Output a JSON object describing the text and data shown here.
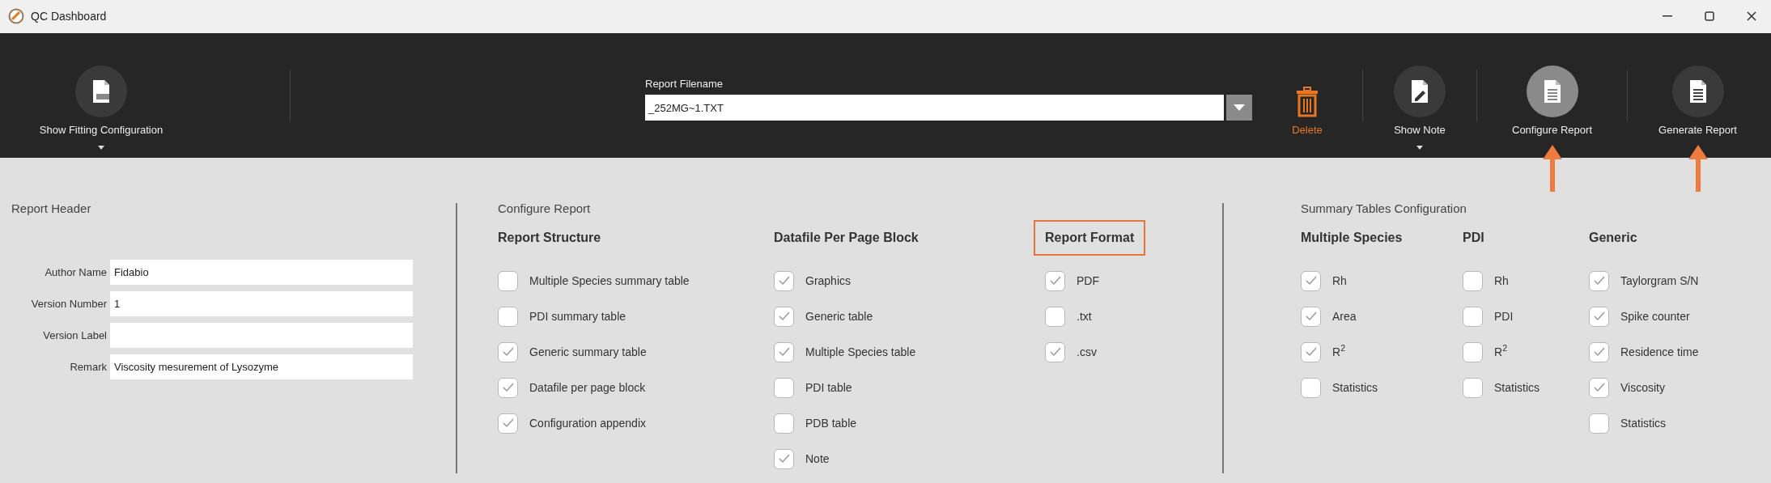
{
  "window": {
    "title": "QC Dashboard"
  },
  "toolbar": {
    "left_buttons": [
      {
        "label": "Show Fitting Configuration",
        "kind": "menu",
        "selected": false,
        "annotated": false
      }
    ],
    "filename": {
      "label": "Report Filename",
      "value": "_252MG~1.TXT"
    },
    "right_buttons": [
      {
        "label": "Delete",
        "kind": "delete",
        "annotated": false
      },
      {
        "label": "Show Note",
        "kind": "menu",
        "selected": false,
        "annotated": false
      },
      {
        "label": "Configure Report",
        "kind": "action",
        "selected": true,
        "annotated": true
      },
      {
        "label": "Generate Report",
        "kind": "action",
        "selected": false,
        "annotated": true
      }
    ]
  },
  "report_header": {
    "title": "Report Header",
    "fields": [
      {
        "label": "Author Name",
        "value": "Fidabio"
      },
      {
        "label": "Version Number",
        "value": "1"
      },
      {
        "label": "Version Label"
      },
      {
        "label": "Remark",
        "value": "Viscosity mesurement of Lysozyme"
      }
    ]
  },
  "configure_report": {
    "title": "Configure Report",
    "groups": [
      {
        "heading": "Report Structure",
        "highlighted": false,
        "options": [
          {
            "label": "Multiple Species summary table",
            "checked": false
          },
          {
            "label": "PDI summary table",
            "checked": false
          },
          {
            "label": "Generic summary table",
            "checked": true
          },
          {
            "label": "Datafile per page block",
            "checked": true
          },
          {
            "label": "Configuration appendix",
            "checked": true
          }
        ]
      },
      {
        "heading": "Datafile Per Page Block",
        "highlighted": false,
        "options": [
          {
            "label": "Graphics",
            "checked": true
          },
          {
            "label": "Generic table",
            "checked": true
          },
          {
            "label": "Multiple Species table",
            "checked": true
          },
          {
            "label": "PDI table",
            "checked": false
          },
          {
            "label": "PDB table",
            "checked": false
          },
          {
            "label": "Note",
            "checked": true
          }
        ]
      },
      {
        "heading": "Report Format",
        "highlighted": true,
        "options": [
          {
            "label": "PDF",
            "checked": true
          },
          {
            "label": ".txt",
            "checked": false
          },
          {
            "label": ".csv",
            "checked": true
          }
        ]
      }
    ]
  },
  "summary_tables": {
    "title": "Summary Tables Configuration",
    "groups": [
      {
        "heading": "Multiple Species",
        "highlighted": false,
        "options": [
          {
            "label": "Rh",
            "checked": true
          },
          {
            "label": "Area",
            "checked": true
          },
          {
            "label": "R$^{2}$",
            "checked": true
          },
          {
            "label": "Statistics",
            "checked": false
          }
        ]
      },
      {
        "heading": "PDI",
        "highlighted": false,
        "options": [
          {
            "label": "Rh",
            "checked": false
          },
          {
            "label": "PDI",
            "checked": false
          },
          {
            "label": "R$^{2}$",
            "checked": false
          },
          {
            "label": "Statistics",
            "checked": false
          }
        ]
      },
      {
        "heading": "Generic",
        "highlighted": false,
        "options": [
          {
            "label": "Taylorgram S/N",
            "checked": true
          },
          {
            "label": "Spike counter",
            "checked": true
          },
          {
            "label": "Residence time",
            "checked": true
          },
          {
            "label": "Viscosity",
            "checked": true
          },
          {
            "label": "Statistics",
            "checked": false
          }
        ]
      }
    ]
  }
}
